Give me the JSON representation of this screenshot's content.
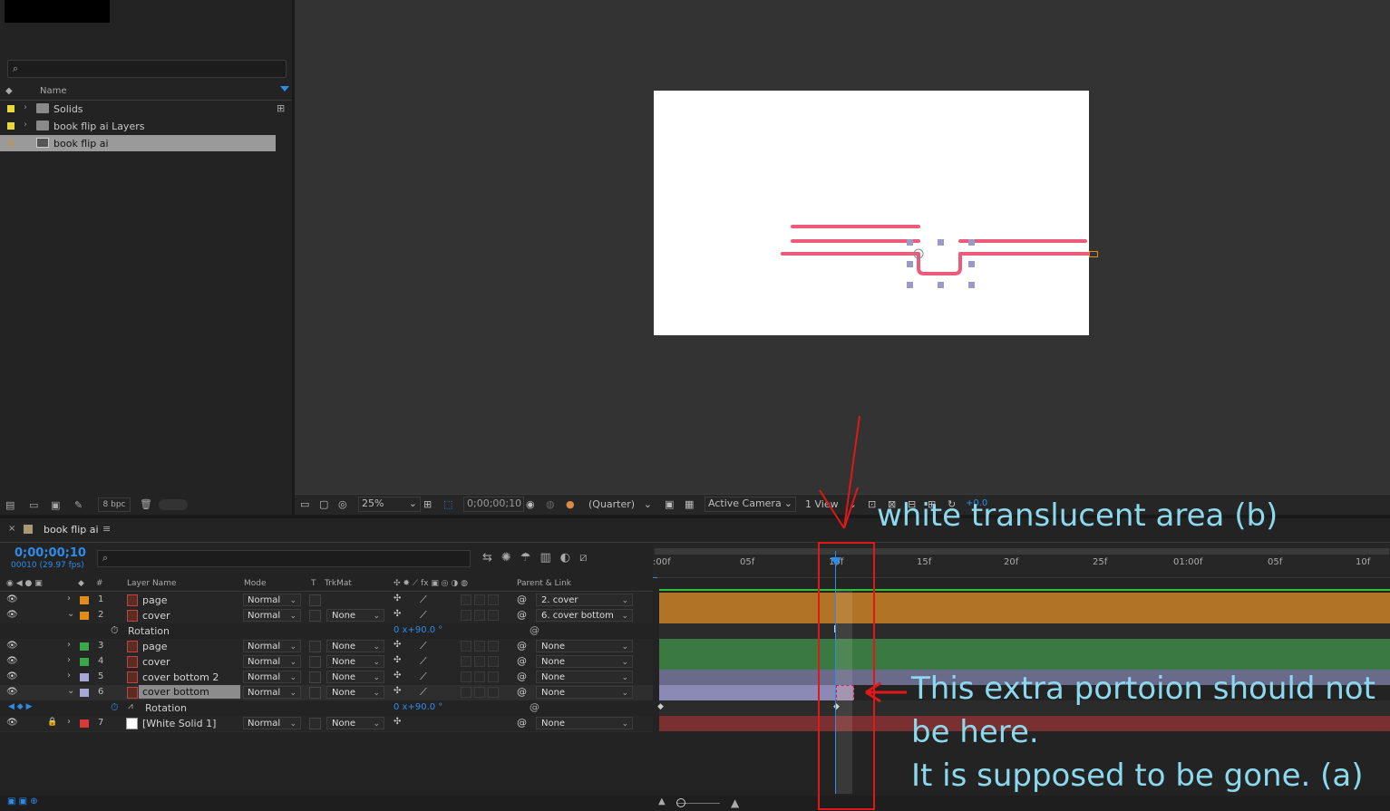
{
  "project": {
    "columns": {
      "name": "Name"
    },
    "items": [
      {
        "label": "Solids",
        "swatch": "#e8d83a"
      },
      {
        "label": "book flip ai Layers",
        "swatch": "#e8d83a"
      },
      {
        "label": "book flip ai",
        "swatch": "#a89876"
      }
    ],
    "footer_bpc": "8 bpc"
  },
  "viewer": {
    "zoom": "25%",
    "timecode": "0;00;00;10",
    "resolution": "(Quarter)",
    "camera": "Active Camera",
    "views": "1 View",
    "exposure": "+0.0"
  },
  "timeline": {
    "tab_label": "book flip ai",
    "current_time": "0;00;00;10",
    "fps_info": "00010 (29.97 fps)",
    "columns": {
      "layer_name": "Layer Name",
      "mode": "Mode",
      "t": "T",
      "trkmat": "TrkMat",
      "parent": "Parent & Link"
    },
    "ruler_ticks": [
      ":00f",
      "05f",
      "10f",
      "15f",
      "20f",
      "25f",
      "01:00f",
      "05f",
      "10f"
    ],
    "layers": [
      {
        "num": "1",
        "name": "page",
        "mode": "Normal",
        "trkmat": "",
        "parent": "2. cover",
        "color": "#e08c1a",
        "twirl": "›"
      },
      {
        "num": "2",
        "name": "cover",
        "mode": "Normal",
        "trkmat": "None",
        "parent": "6. cover bottom",
        "color": "#e08c1a",
        "twirl": "⌄"
      },
      {
        "num": "3",
        "name": "page",
        "mode": "Normal",
        "trkmat": "None",
        "parent": "None",
        "color": "#3aa84a",
        "twirl": "›"
      },
      {
        "num": "4",
        "name": "cover",
        "mode": "Normal",
        "trkmat": "None",
        "parent": "None",
        "color": "#3aa84a",
        "twirl": "›"
      },
      {
        "num": "5",
        "name": "cover bottom 2",
        "mode": "Normal",
        "trkmat": "None",
        "parent": "None",
        "color": "#a8a8d8",
        "twirl": "›"
      },
      {
        "num": "6",
        "name": "cover bottom",
        "mode": "Normal",
        "trkmat": "None",
        "parent": "None",
        "color": "#a8a8d8",
        "twirl": "⌄"
      },
      {
        "num": "7",
        "name": "[White Solid 1]",
        "mode": "Normal",
        "trkmat": "None",
        "parent": "None",
        "color": "#d83a3a",
        "twirl": "›"
      }
    ],
    "rotation_label": "Rotation",
    "rotation_value_2": "0 x+90.0 °",
    "rotation_value_6": "0 x+90.0 °"
  },
  "annotations": {
    "b": "white translucent area (b)",
    "a_line1": "This extra portoion should not",
    "a_line2": "be here.",
    "a_line3": "It is supposed to be gone. (a)"
  },
  "colors": {
    "accent": "#2d8ceb",
    "orange_bar": "#b07424",
    "green_bar": "#3a7a42",
    "lavender_bar": "#6a6a8a",
    "red_bar": "#7a3030",
    "annotation": "#8cd9ee",
    "marker_red": "#e01818"
  }
}
